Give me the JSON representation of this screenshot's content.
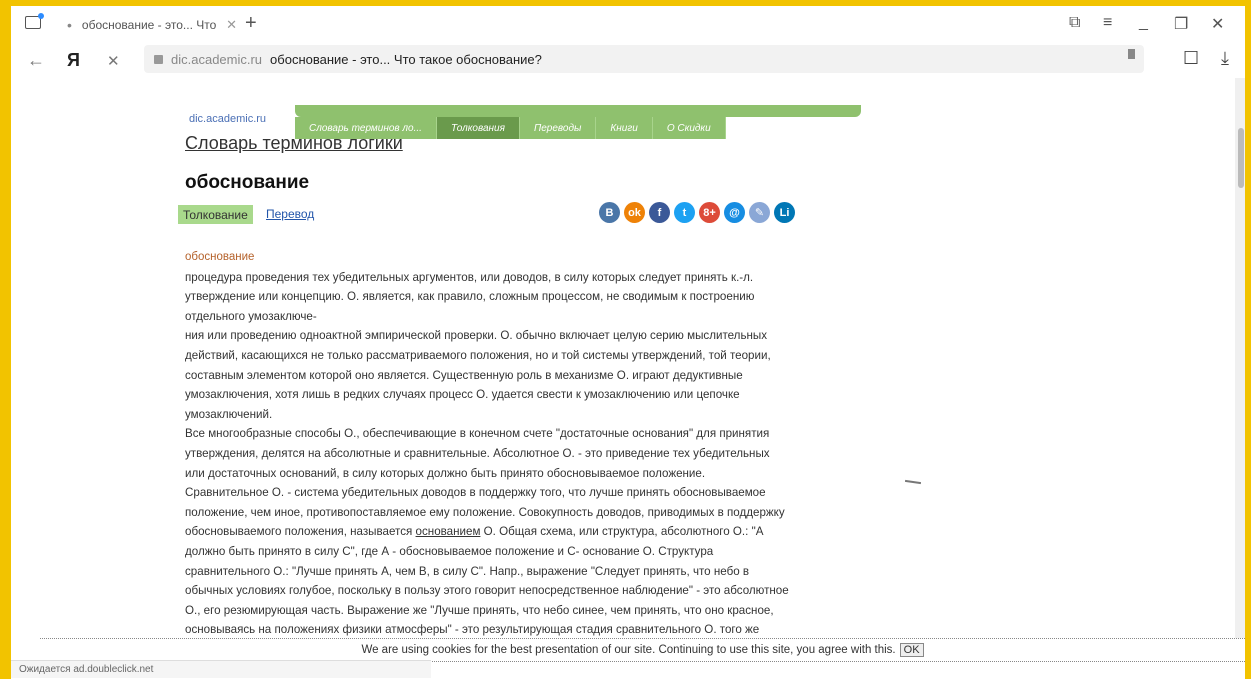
{
  "browser": {
    "tab_title": "обоснование - это... Что",
    "tab_dot": "•",
    "domain": "dic.academic.ru",
    "page_title": "обоснование - это... Что такое обоснование?",
    "back_glyph": "←",
    "yandex_glyph": "Я",
    "stop_glyph": "✕"
  },
  "site": {
    "logo": "dic.academic.ru",
    "nav_tabs": [
      {
        "label": "Словарь терминов ло..."
      },
      {
        "label": "Толкования"
      },
      {
        "label": "Переводы"
      },
      {
        "label": "Книги"
      },
      {
        "label": "О Скидки"
      }
    ]
  },
  "entry": {
    "dictionary_title": "Словарь терминов логики",
    "word": "обоснование",
    "tab_active": "Толкование",
    "tab_link": "Перевод",
    "headword": "обоснование",
    "lines": [
      "процедура проведения тех убедительных аргументов, или доводов, в силу которых следует принять к.-л.",
      "утверждение или концепцию. О. является, как правило, сложным процессом, не сводимым к построению",
      "отдельного умозаключе-",
      "ния или проведению одноактной эмпирической проверки. О. обычно включает целую серию мыслительных",
      "действий, касающихся не только рассматриваемого положения, но и той системы утверждений, той теории,",
      "составным элементом которой оно является. Существенную роль в механизме О. играют дедуктивные",
      "умозаключения, хотя лишь в редких случаях процесс О. удается свести к умозаключению или цепочке",
      "умозаключений.",
      "Все многообразные способы О., обеспечивающие в конечном счете \"достаточные основания\" для принятия",
      "утверждения, делятся на абсолютные и сравнительные. Абсолютное О. - это приведение тех убедительных",
      "или достаточных оснований, в силу которых должно быть принято обосновываемое положение.",
      "Сравнительное О. - система убедительных доводов в поддержку того, что лучше принять обосновываемое",
      "положение, чем иное, противопоставляемое ему положение. Совокупность доводов, приводимых в поддержку"
    ],
    "line_with_link": {
      "before": "обосновываемого положения, называется ",
      "link": "основанием",
      "after": " О. Общая схема, или структура, абсолютного О.: \"А"
    },
    "lines2": [
      "должно быть принято в силу С\", где А - обосновываемое положение и С- основание О. Структура",
      "сравнительного О.: \"Лучше принять А, чем В, в силу С\". Напр., выражение \"Следует принять, что небо в",
      "обычных условиях голубое, поскольку в пользу этого говорит непосредственное наблюдение\" - это абсолютное",
      "О., его резюмирующая часть. Выражение же \"Лучше принять, что небо синее, чем принять, что оно красное,",
      "основываясь на положениях физики атмосферы\" - это результирующая стадия сравнительного О. того же"
    ]
  },
  "social": [
    {
      "label": "B",
      "color": "#4a76a8",
      "name": "vk-icon"
    },
    {
      "label": "ok",
      "color": "#ee8208",
      "name": "odnoklassniki-icon"
    },
    {
      "label": "f",
      "color": "#3b5998",
      "name": "facebook-icon"
    },
    {
      "label": "t",
      "color": "#1da1f2",
      "name": "twitter-icon"
    },
    {
      "label": "8+",
      "color": "#dd4b39",
      "name": "google-plus-icon"
    },
    {
      "label": "@",
      "color": "#168de2",
      "name": "mail-icon"
    },
    {
      "label": "✎",
      "color": "#8aa7d6",
      "name": "livejournal-icon"
    },
    {
      "label": "Li",
      "color": "#0077b5",
      "name": "liveinternet-icon"
    }
  ],
  "cookie": {
    "text": "We are using cookies for the best presentation of our site. Continuing to use this site, you agree with this.",
    "ok": "OK"
  },
  "status": "Ожидается ad.doubleclick.net"
}
